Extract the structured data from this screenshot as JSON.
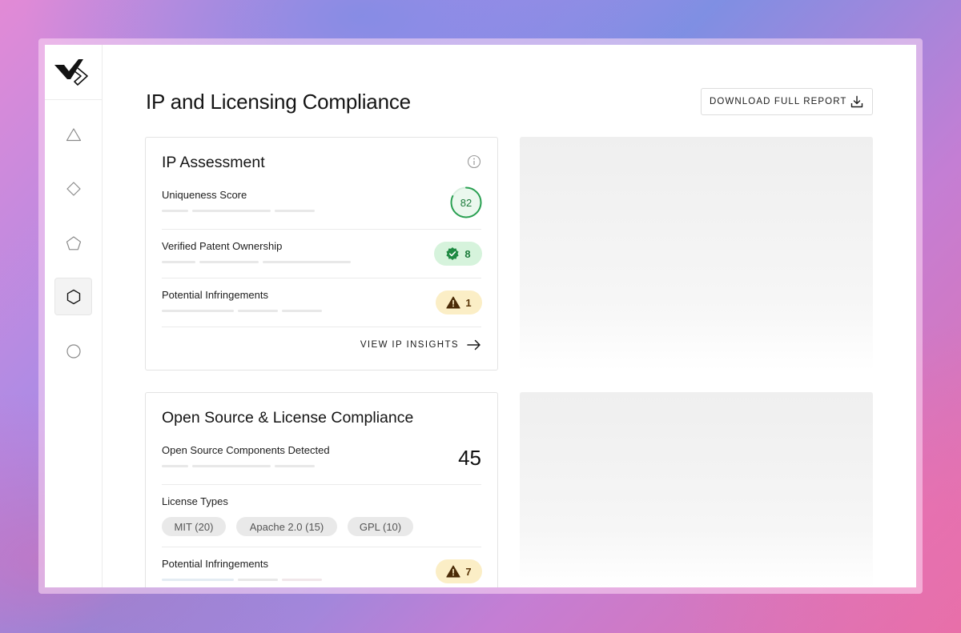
{
  "page": {
    "title": "IP and Licensing Compliance",
    "download_label": "DOWNLOAD FULL REPORT"
  },
  "sidebar": {
    "items": [
      {
        "icon": "triangle-icon"
      },
      {
        "icon": "diamond-icon"
      },
      {
        "icon": "pentagon-icon"
      },
      {
        "icon": "hexagon-icon",
        "active": true
      },
      {
        "icon": "circle-icon"
      }
    ]
  },
  "ip_assessment": {
    "title": "IP Assessment",
    "uniqueness_label": "Uniqueness Score",
    "uniqueness_value": "82",
    "uniqueness_fraction": 0.82,
    "patent_label": "Verified Patent Ownership",
    "patent_value": "8",
    "infringements_label": "Potential Infringements",
    "infringements_value": "1",
    "link_label": "VIEW IP INSIGHTS"
  },
  "open_source": {
    "title": "Open Source & License Compliance",
    "components_label": "Open Source Components Detected",
    "components_value": "45",
    "license_types_label": "License Types",
    "licenses": [
      "MIT (20)",
      "Apache 2.0 (15)",
      "GPL (10)"
    ],
    "infringements_label": "Potential Infringements",
    "infringements_value": "7"
  },
  "colors": {
    "success": "#1d7c3c",
    "success_bg": "#d6f3dc",
    "warning_bg": "#fbeec6",
    "warning_icon": "#4a2a06"
  }
}
